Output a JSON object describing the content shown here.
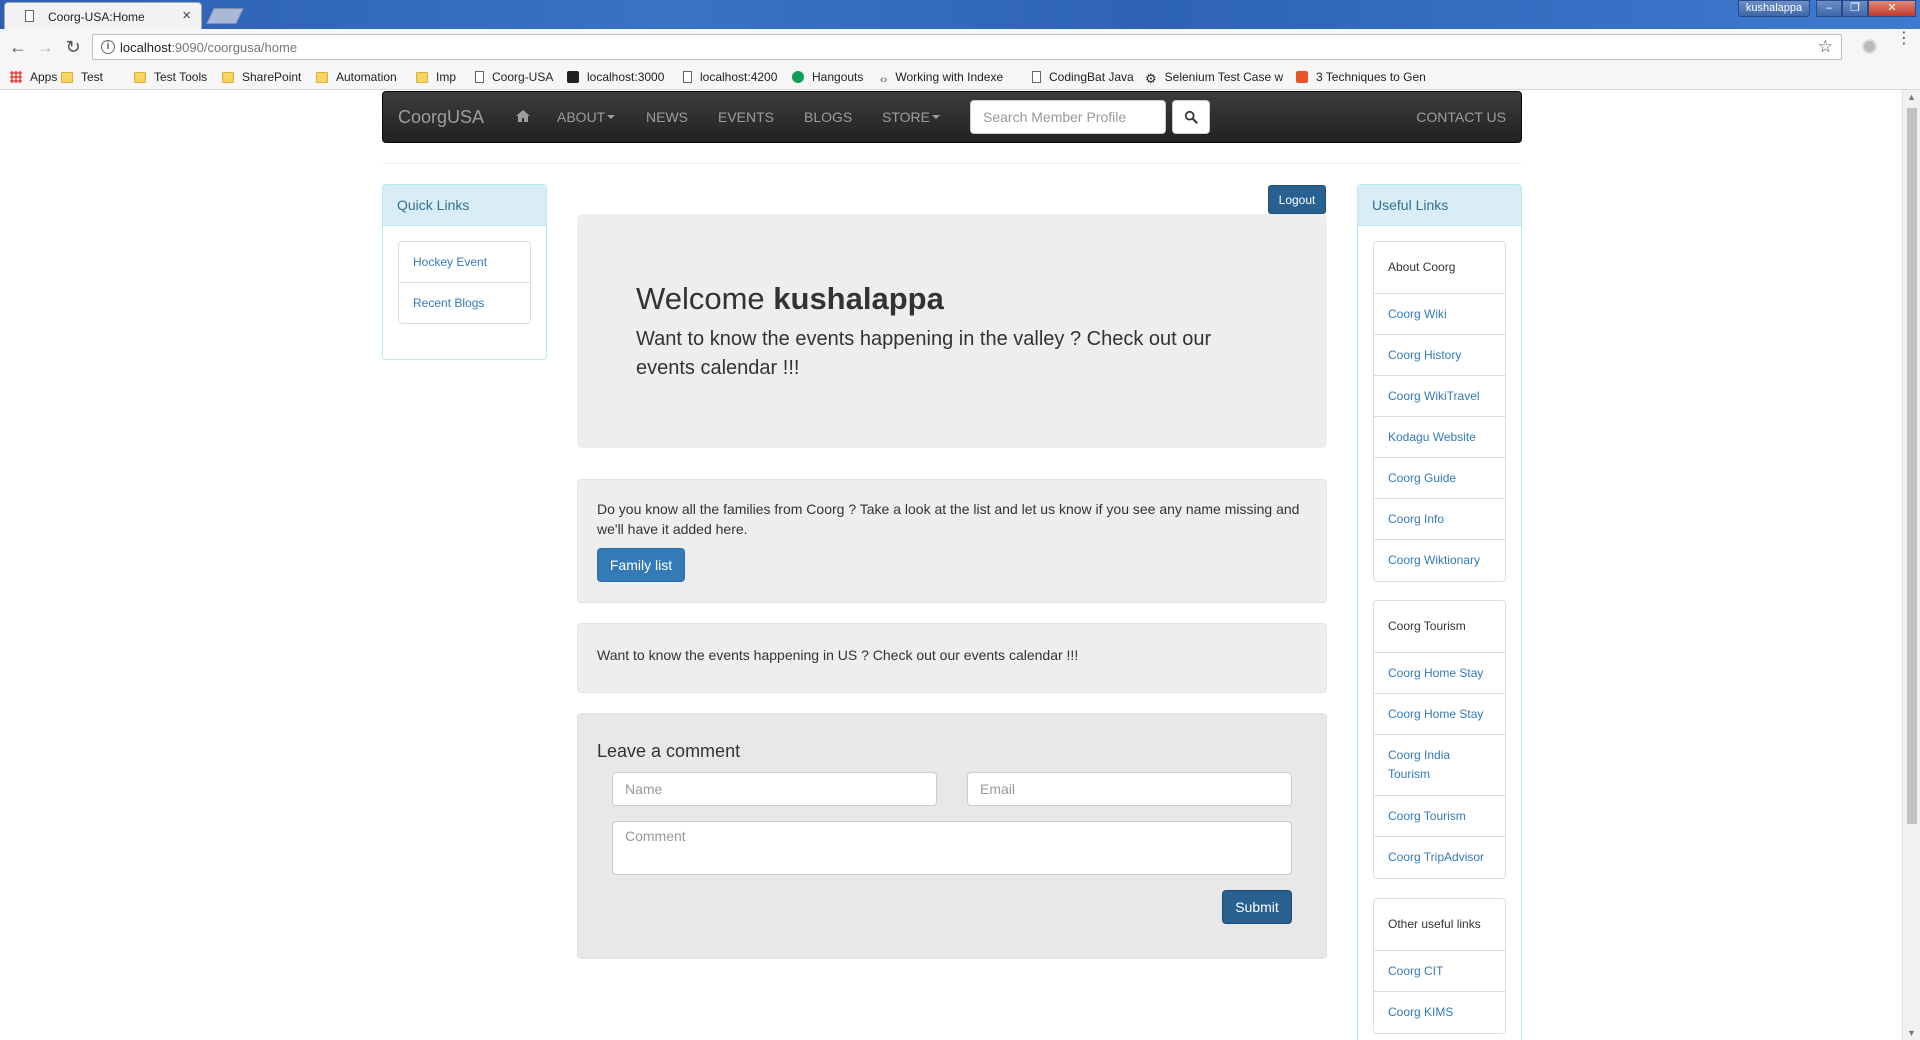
{
  "browser": {
    "tab_title": "Coorg-USA:Home",
    "tab_close": "×",
    "user_name": "kushalappa",
    "window_min": "‒",
    "window_max": "❐",
    "window_close": "✕",
    "url_host": "localhost",
    "url_rest": ":9090/coorgusa/home",
    "back_icon": "←",
    "forward_icon": "→",
    "reload_icon": "↻",
    "star_icon": "☆",
    "menu_icon": "⋮",
    "bookmarks": [
      {
        "label": "Apps",
        "icon": "apps"
      },
      {
        "label": "Test",
        "icon": "folder"
      },
      {
        "label": "Test Tools",
        "icon": "folder"
      },
      {
        "label": "SharePoint",
        "icon": "folder"
      },
      {
        "label": "Automation",
        "icon": "folder"
      },
      {
        "label": "Imp",
        "icon": "folder"
      },
      {
        "label": "Coorg-USA",
        "icon": "doc"
      },
      {
        "label": "localhost:3000",
        "icon": "gh"
      },
      {
        "label": "localhost:4200",
        "icon": "doc"
      },
      {
        "label": "Hangouts",
        "icon": "hang"
      },
      {
        "label": "Working with Indexe",
        "icon": "code"
      },
      {
        "label": "CodingBat Java",
        "icon": "doc"
      },
      {
        "label": "Selenium Test Case w",
        "icon": "gear"
      },
      {
        "label": "3 Techniques to Gen",
        "icon": "orange"
      }
    ]
  },
  "site_nav": {
    "brand": "CoorgUSA",
    "links": {
      "about": "ABOUT",
      "news": "NEWS",
      "events": "EVENTS",
      "blogs": "BLOGS",
      "store": "STORE"
    },
    "search_placeholder": "Search Member Profile",
    "contact": "CONTACT US"
  },
  "quick_links": {
    "heading": "Quick Links",
    "items": [
      "Hockey Event",
      "Recent Blogs"
    ]
  },
  "main": {
    "logout_label": "Logout",
    "welcome_prefix": "Welcome",
    "user_name": "kushalappa",
    "welcome_sub": "Want to know the events happening in the valley ? Check out our events calendar !!!",
    "families_text": "Do you know all the families from Coorg ? Take a look at the list and let us know if you see any name missing and we'll have it added here.",
    "family_btn": "Family list",
    "us_events_text": "Want to know the events happening in US ? Check out our events calendar !!!",
    "comment": {
      "title": "Leave a comment",
      "name_placeholder": "Name",
      "email_placeholder": "Email",
      "comment_placeholder": "Comment",
      "submit": "Submit"
    }
  },
  "useful_links": {
    "heading": "Useful Links",
    "groups": [
      {
        "title": "About Coorg",
        "items": [
          "Coorg Wiki",
          "Coorg History",
          "Coorg WikiTravel",
          "Kodagu Website",
          "Coorg Guide",
          "Coorg Info",
          "Coorg Wiktionary"
        ]
      },
      {
        "title": "Coorg Tourism",
        "items": [
          "Coorg Home Stay",
          "Coorg Home Stay",
          "Coorg India Tourism",
          "Coorg Tourism",
          "Coorg TripAdvisor"
        ]
      },
      {
        "title": "Other useful links",
        "items": [
          "Coorg CIT",
          "Coorg KIMS"
        ]
      }
    ]
  },
  "colors": {
    "navbar_bg": "#222222",
    "link": "#337ab7",
    "primary_btn": "#286090",
    "panel_heading": "#d9edf7"
  }
}
